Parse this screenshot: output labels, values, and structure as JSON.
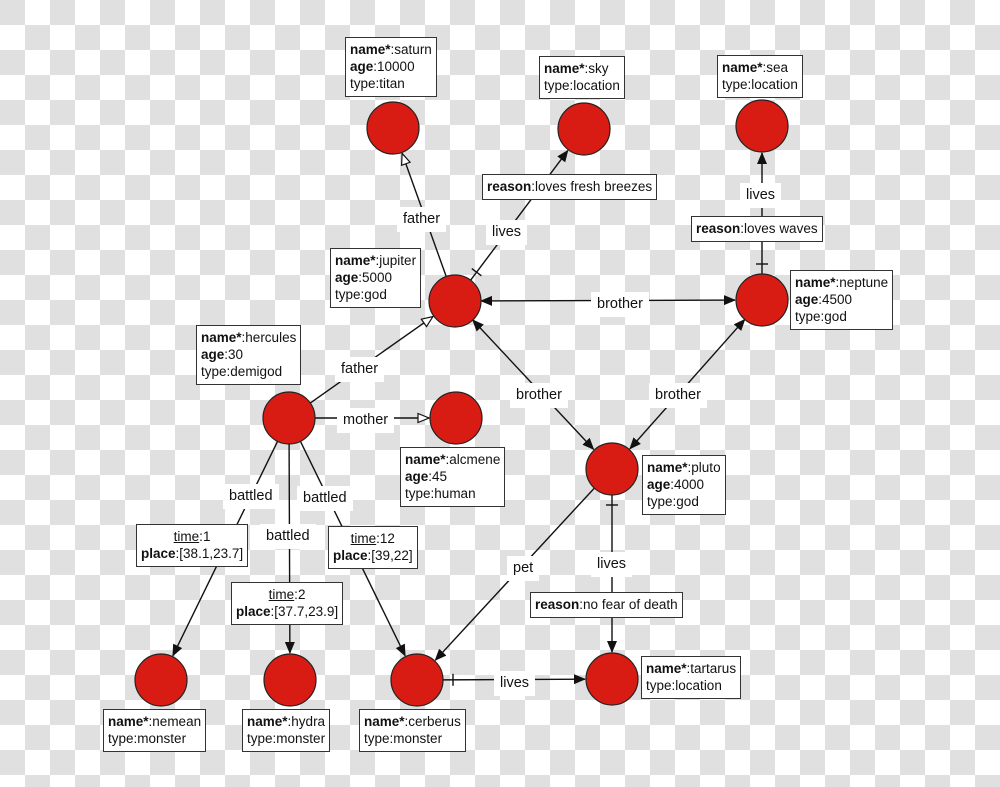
{
  "colors": {
    "node_fill": "#d81c14",
    "node_stroke": "#222222",
    "edge": "#111111",
    "checker": "#e0e0e0"
  },
  "nodes": {
    "saturn": {
      "props": [
        {
          "key": "name*",
          "bold": true,
          "value": "saturn"
        },
        {
          "key": "age",
          "bold": true,
          "value": "10000"
        },
        {
          "key": "type",
          "bold": false,
          "value": "titan"
        }
      ]
    },
    "sky": {
      "props": [
        {
          "key": "name*",
          "bold": true,
          "value": "sky"
        },
        {
          "key": "type",
          "bold": false,
          "value": "location"
        }
      ]
    },
    "sea": {
      "props": [
        {
          "key": "name*",
          "bold": true,
          "value": "sea"
        },
        {
          "key": "type",
          "bold": false,
          "value": "location"
        }
      ]
    },
    "jupiter": {
      "props": [
        {
          "key": "name*",
          "bold": true,
          "value": "jupiter"
        },
        {
          "key": "age",
          "bold": true,
          "value": "5000"
        },
        {
          "key": "type",
          "bold": false,
          "value": "god"
        }
      ]
    },
    "neptune": {
      "props": [
        {
          "key": "name*",
          "bold": true,
          "value": "neptune"
        },
        {
          "key": "age",
          "bold": true,
          "value": "4500"
        },
        {
          "key": "type",
          "bold": false,
          "value": "god"
        }
      ]
    },
    "hercules": {
      "props": [
        {
          "key": "name*",
          "bold": true,
          "value": "hercules"
        },
        {
          "key": "age",
          "bold": true,
          "value": "30"
        },
        {
          "key": "type",
          "bold": false,
          "value": "demigod"
        }
      ]
    },
    "alcmene": {
      "props": [
        {
          "key": "name*",
          "bold": true,
          "value": "alcmene"
        },
        {
          "key": "age",
          "bold": true,
          "value": "45"
        },
        {
          "key": "type",
          "bold": false,
          "value": "human"
        }
      ]
    },
    "pluto": {
      "props": [
        {
          "key": "name*",
          "bold": true,
          "value": "pluto"
        },
        {
          "key": "age",
          "bold": true,
          "value": "4000"
        },
        {
          "key": "type",
          "bold": false,
          "value": "god"
        }
      ]
    },
    "nemean": {
      "props": [
        {
          "key": "name*",
          "bold": true,
          "value": "nemean"
        },
        {
          "key": "type",
          "bold": false,
          "value": "monster"
        }
      ]
    },
    "hydra": {
      "props": [
        {
          "key": "name*",
          "bold": true,
          "value": "hydra"
        },
        {
          "key": "type",
          "bold": false,
          "value": "monster"
        }
      ]
    },
    "cerberus": {
      "props": [
        {
          "key": "name*",
          "bold": true,
          "value": "cerberus"
        },
        {
          "key": "type",
          "bold": false,
          "value": "monster"
        }
      ]
    },
    "tartarus": {
      "props": [
        {
          "key": "name*",
          "bold": true,
          "value": "tartarus"
        },
        {
          "key": "type",
          "bold": false,
          "value": "location"
        }
      ]
    }
  },
  "edges": [
    {
      "id": "jupiter-saturn",
      "from": "jupiter",
      "to": "saturn",
      "label": "father",
      "arrow": "open"
    },
    {
      "id": "jupiter-sky",
      "from": "jupiter",
      "to": "sky",
      "label": "lives",
      "arrow": "filled",
      "props": [
        {
          "key": "reason",
          "bold": true,
          "value": "loves fresh breezes"
        }
      ]
    },
    {
      "id": "neptune-sea",
      "from": "neptune",
      "to": "sea",
      "label": "lives",
      "arrow": "filled",
      "props": [
        {
          "key": "reason",
          "bold": true,
          "value": "loves waves"
        }
      ]
    },
    {
      "id": "jupiter-neptune",
      "from": "jupiter",
      "to": "neptune",
      "label": "brother",
      "arrow": "both"
    },
    {
      "id": "hercules-jupiter",
      "from": "hercules",
      "to": "jupiter",
      "label": "father",
      "arrow": "open"
    },
    {
      "id": "hercules-alcmene",
      "from": "hercules",
      "to": "alcmene",
      "label": "mother",
      "arrow": "open"
    },
    {
      "id": "jupiter-pluto",
      "from": "jupiter",
      "to": "pluto",
      "label": "brother",
      "arrow": "both"
    },
    {
      "id": "neptune-pluto",
      "from": "neptune",
      "to": "pluto",
      "label": "brother",
      "arrow": "both"
    },
    {
      "id": "hercules-nemean",
      "from": "hercules",
      "to": "nemean",
      "label": "battled",
      "arrow": "filled",
      "props": [
        {
          "key": "time",
          "underline": true,
          "value": "1"
        },
        {
          "key": "place",
          "bold": true,
          "value": "[38.1,23.7]"
        }
      ]
    },
    {
      "id": "hercules-hydra",
      "from": "hercules",
      "to": "hydra",
      "label": "battled",
      "arrow": "filled",
      "props": [
        {
          "key": "time",
          "underline": true,
          "value": "2"
        },
        {
          "key": "place",
          "bold": true,
          "value": "[37.7,23.9]"
        }
      ]
    },
    {
      "id": "hercules-cerberus",
      "from": "hercules",
      "to": "cerberus",
      "label": "battled",
      "arrow": "filled",
      "props": [
        {
          "key": "time",
          "underline": true,
          "value": "12"
        },
        {
          "key": "place",
          "bold": true,
          "value": "[39,22]"
        }
      ]
    },
    {
      "id": "pluto-cerberus",
      "from": "pluto",
      "to": "cerberus",
      "label": "pet",
      "arrow": "filled"
    },
    {
      "id": "pluto-tartarus",
      "from": "pluto",
      "to": "tartarus",
      "label": "lives",
      "arrow": "filled",
      "props": [
        {
          "key": "reason",
          "bold": true,
          "value": "no fear of death"
        }
      ]
    },
    {
      "id": "cerberus-tartarus",
      "from": "cerberus",
      "to": "tartarus",
      "label": "lives",
      "arrow": "filled"
    }
  ]
}
